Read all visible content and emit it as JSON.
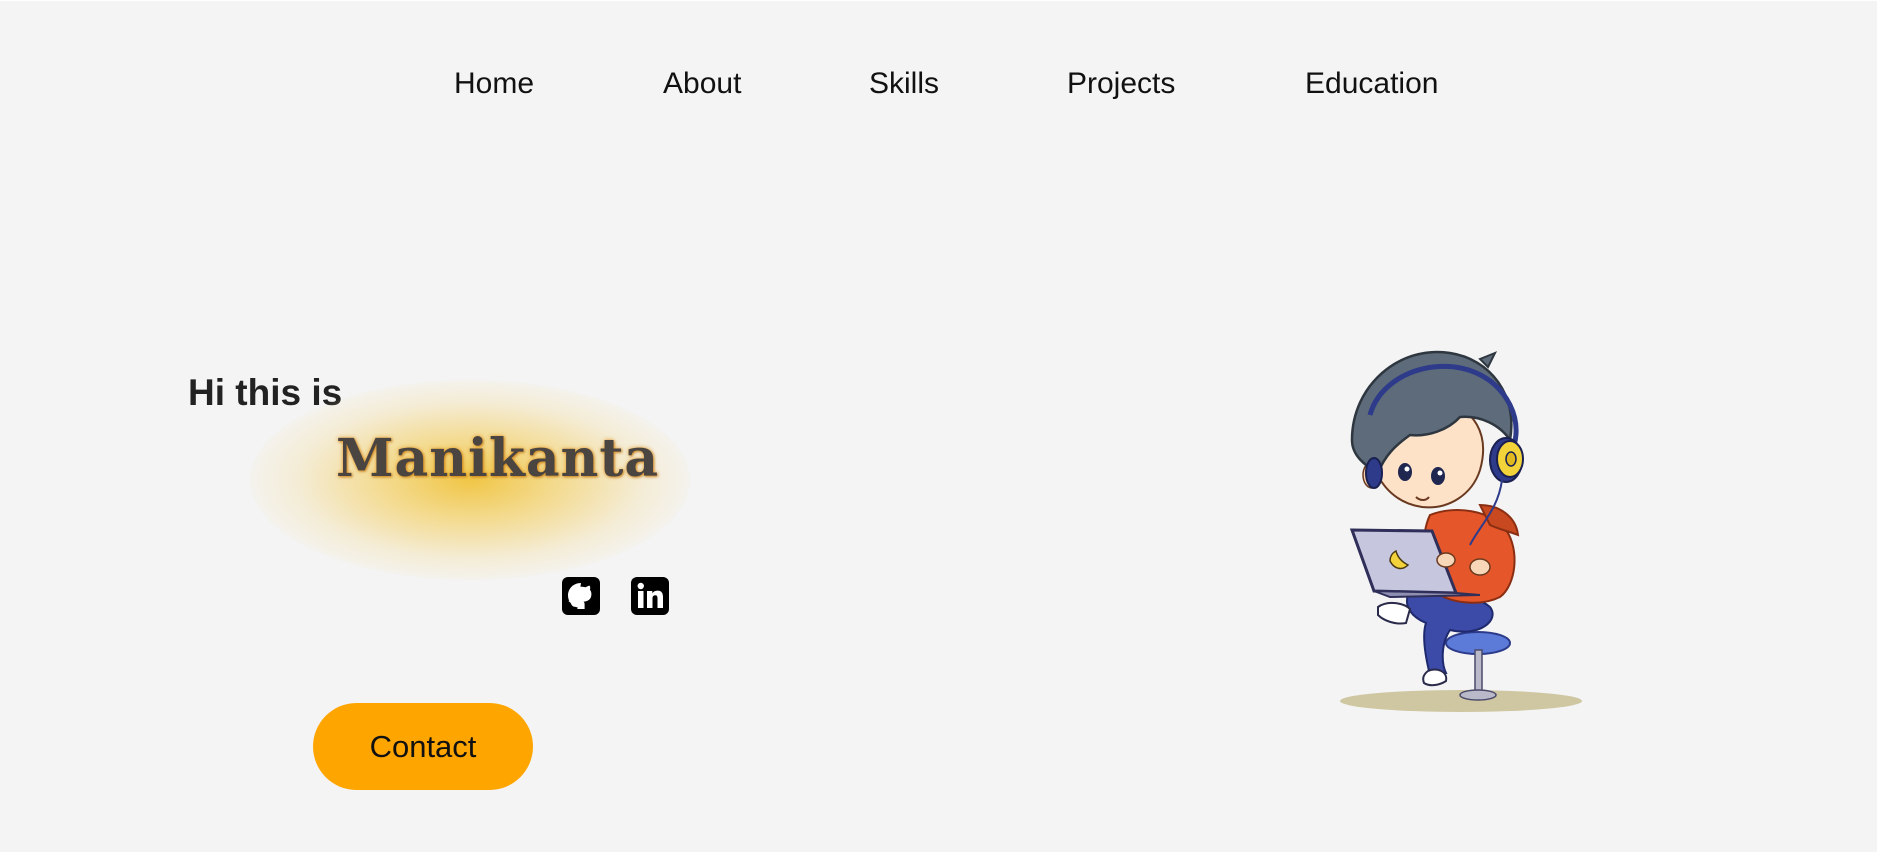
{
  "nav": {
    "items": [
      {
        "label": "Home"
      },
      {
        "label": "About"
      },
      {
        "label": "Skills"
      },
      {
        "label": "Projects"
      },
      {
        "label": "Education"
      }
    ]
  },
  "hero": {
    "greeting": "Hi this is",
    "name": "Manikanta",
    "social": [
      {
        "icon": "github-icon"
      },
      {
        "icon": "linkedin-icon"
      }
    ],
    "contact_label": "Contact"
  },
  "colors": {
    "background": "#f4f4f4",
    "accent": "#ffa500",
    "glow": "#f0be28",
    "text": "#111111"
  },
  "illustration": {
    "subject": "boy-with-laptop-illustration"
  }
}
